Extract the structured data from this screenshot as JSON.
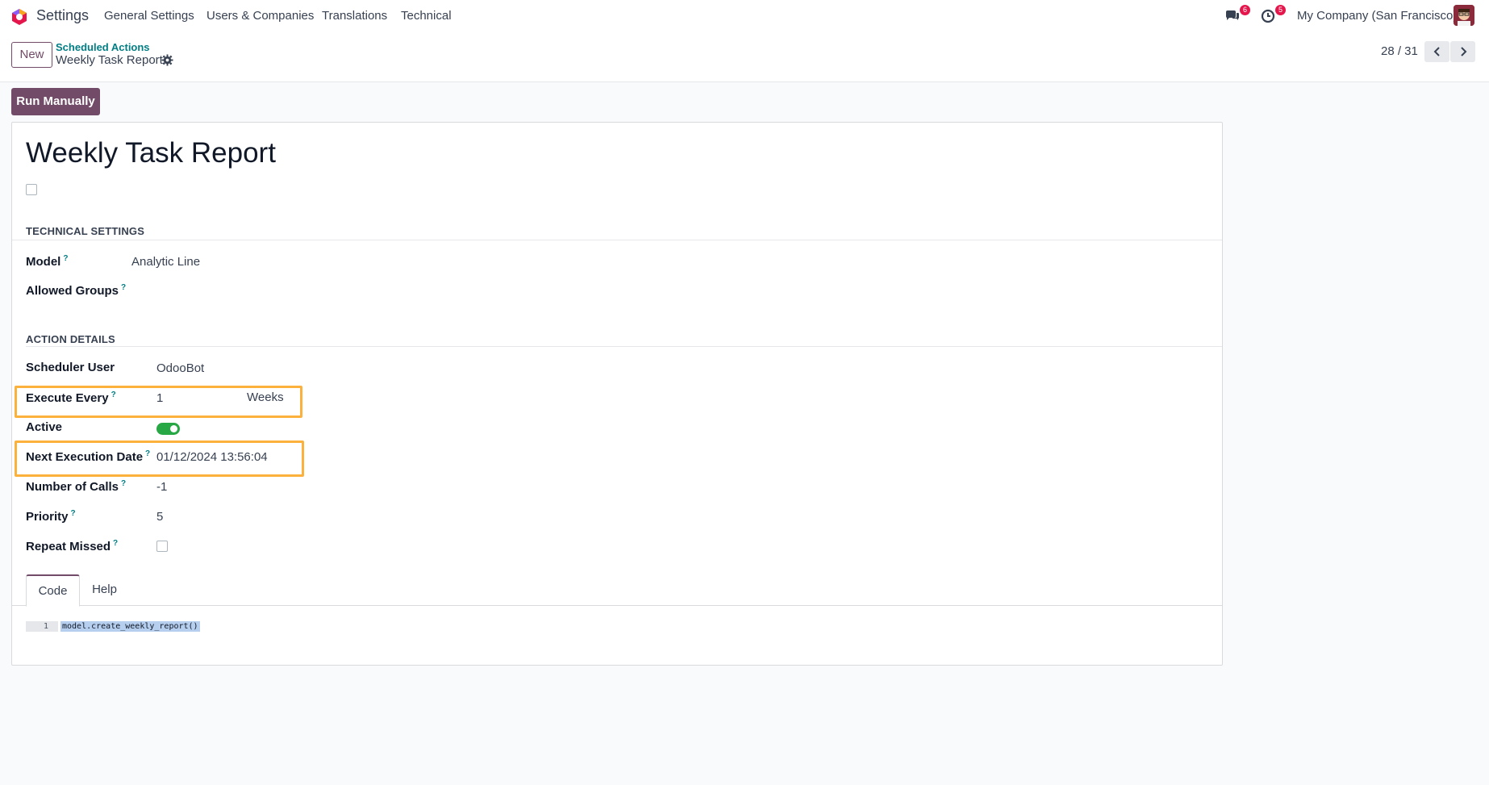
{
  "navbar": {
    "app_name": "Settings",
    "menu": [
      "General Settings",
      "Users & Companies",
      "Translations",
      "Technical"
    ],
    "messages_count": "6",
    "activities_count": "5",
    "company": "My Company (San Francisco)",
    "icons": {
      "logo": "odoo-logo-icon",
      "messages": "chat-icon",
      "activities": "clock-icon",
      "avatar": "user-avatar"
    }
  },
  "control_panel": {
    "new_label": "New",
    "breadcrumb_parent": "Scheduled Actions",
    "breadcrumb_current": "Weekly Task Report",
    "pager": "28 / 31"
  },
  "actions": {
    "run_manually": "Run Manually"
  },
  "form": {
    "title": "Weekly Task Report",
    "technical_settings": {
      "section_title": "TECHNICAL SETTINGS",
      "model_label": "Model",
      "model_value": "Analytic Line",
      "groups_label": "Allowed Groups",
      "groups_value": ""
    },
    "action_details": {
      "section_title": "ACTION DETAILS",
      "scheduler_user_label": "Scheduler User",
      "scheduler_user_value": "OdooBot",
      "execute_every_label": "Execute Every",
      "execute_every_value": "1",
      "execute_every_unit": "Weeks",
      "active_label": "Active",
      "active_value": true,
      "next_execution_label": "Next Execution Date",
      "next_execution_value": "01/12/2024 13:56:04",
      "number_of_calls_label": "Number of Calls",
      "number_of_calls_value": "-1",
      "priority_label": "Priority",
      "priority_value": "5",
      "repeat_missed_label": "Repeat Missed"
    },
    "tabs": [
      "Code",
      "Help"
    ],
    "code": {
      "line_number": "1",
      "text": "model.create_weekly_report()"
    }
  },
  "colors": {
    "brand": "#714b67",
    "link": "#017e84",
    "highlight": "#fbb13c",
    "toggle_on": "#28a745"
  }
}
